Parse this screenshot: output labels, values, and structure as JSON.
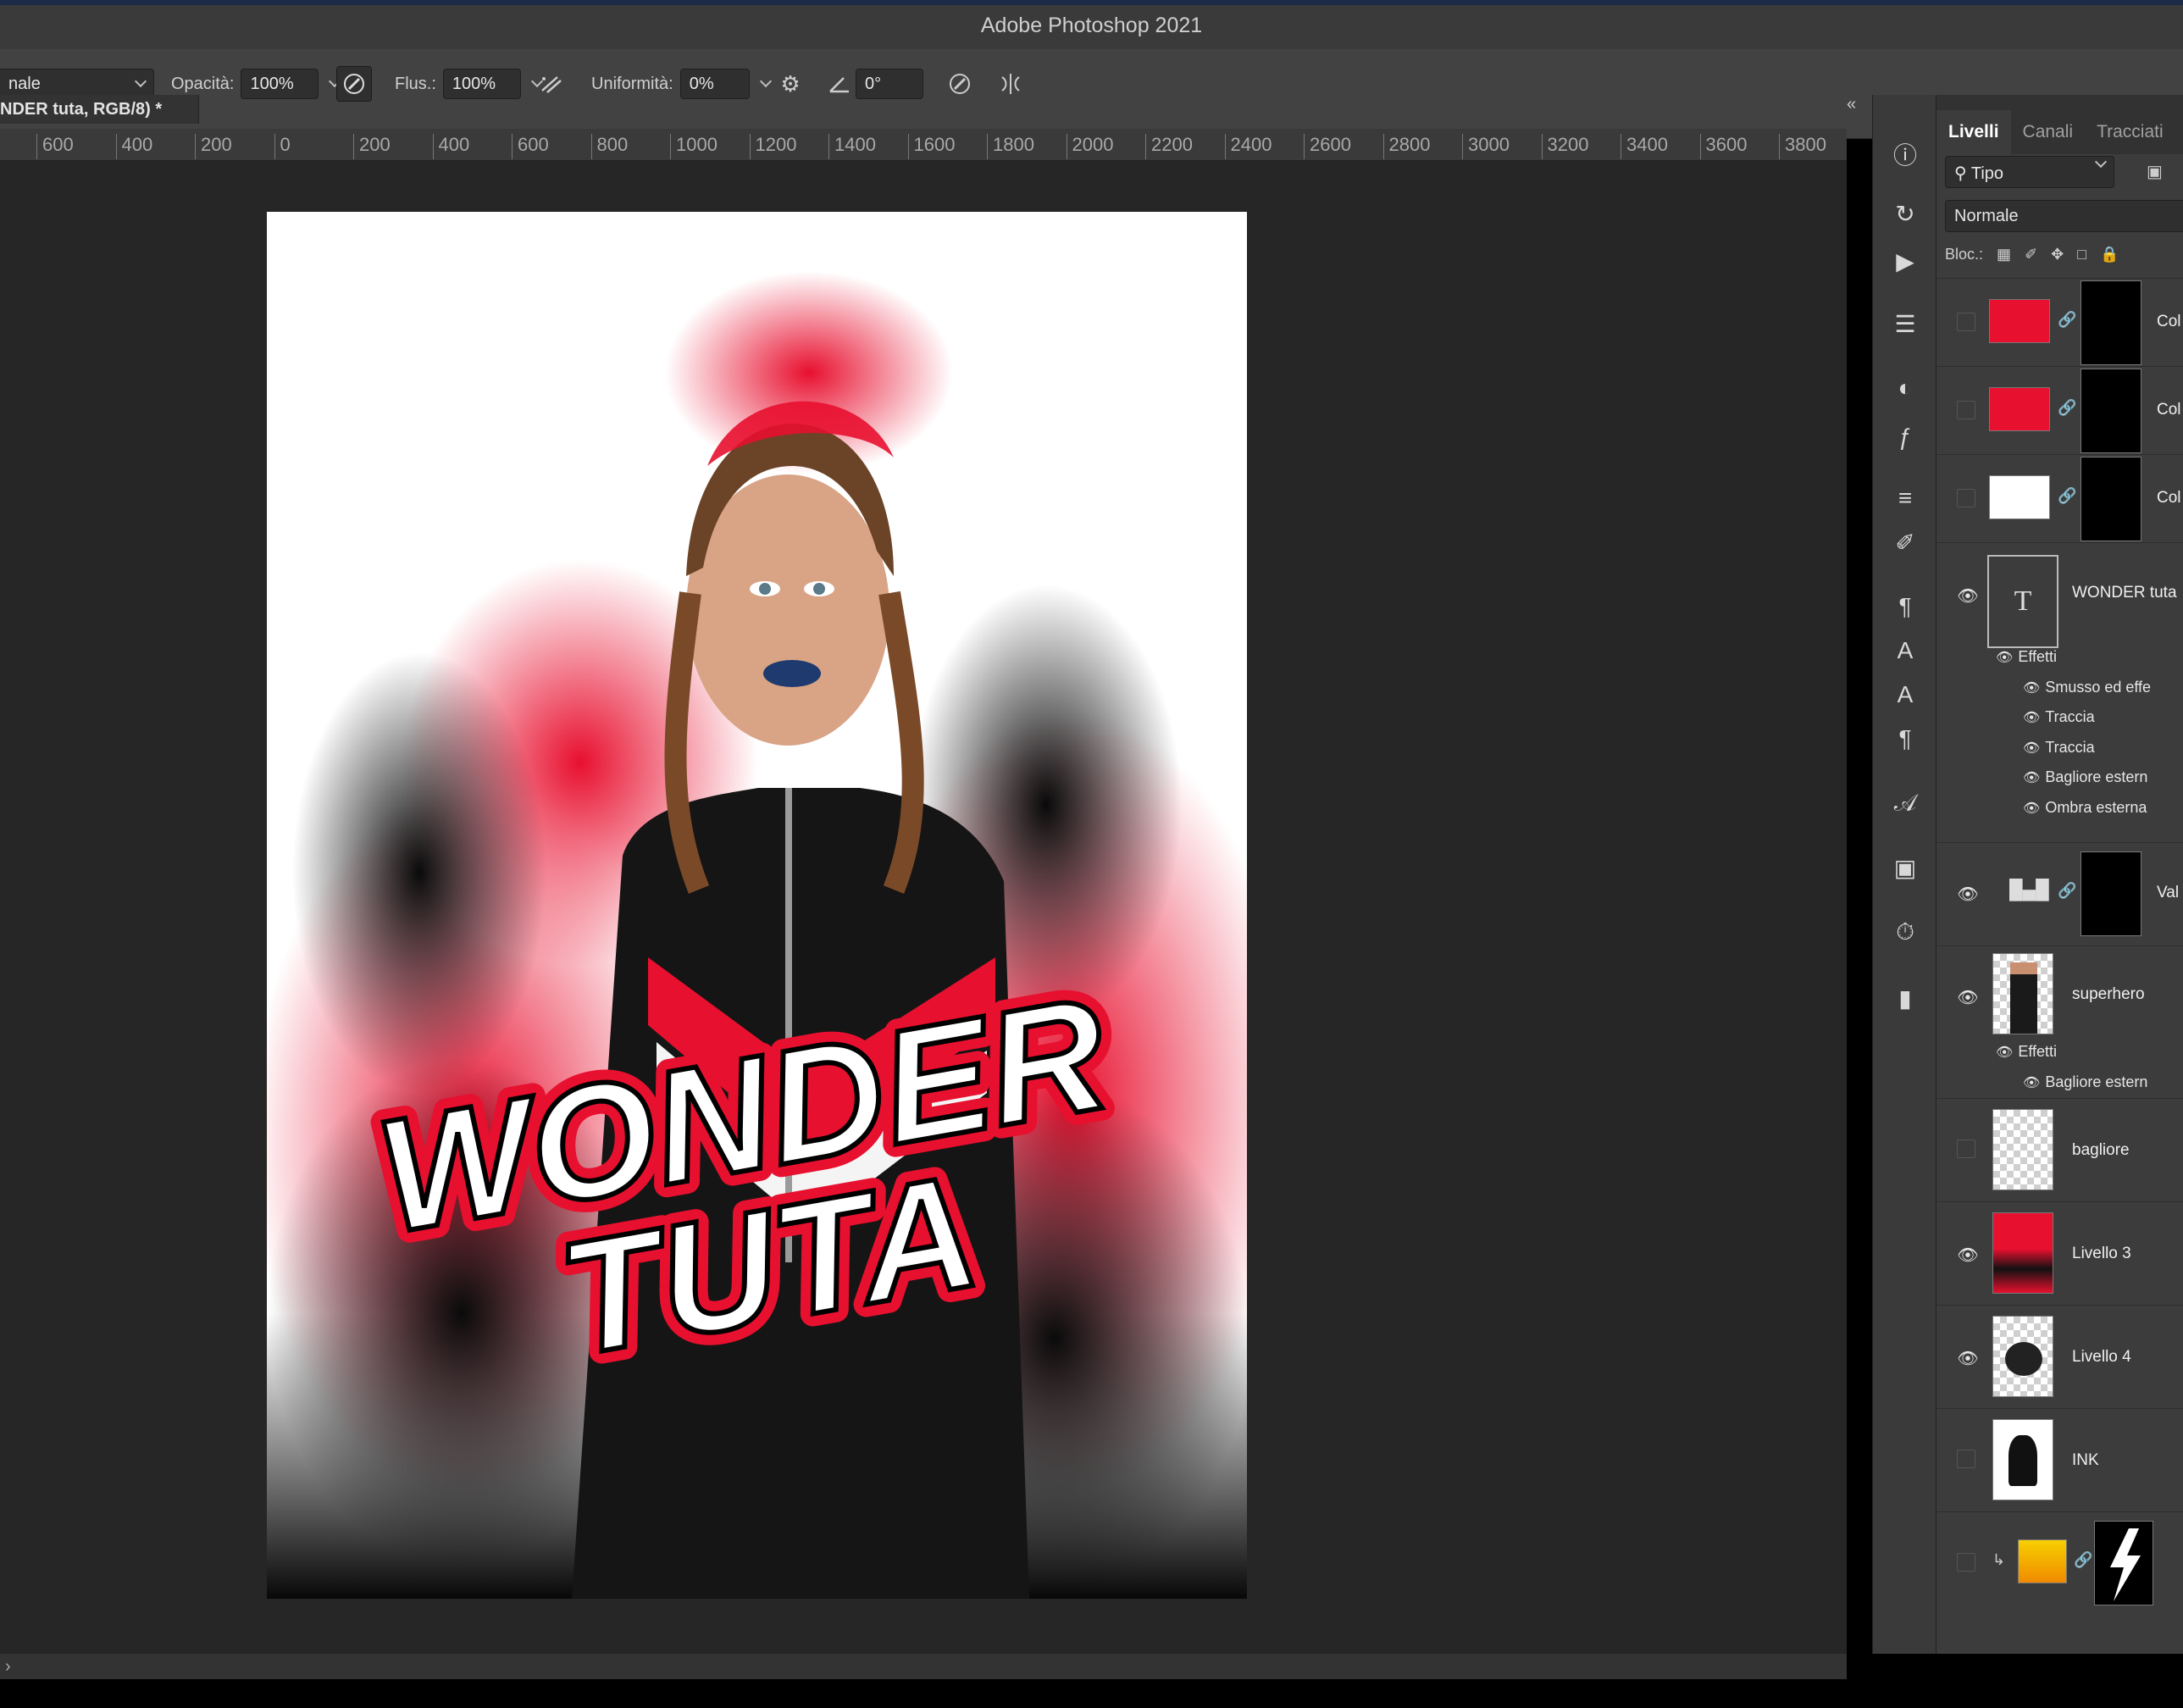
{
  "app_title": "Adobe Photoshop 2021",
  "options_bar": {
    "blend_mode": "nale",
    "opacity_label": "Opacità:",
    "opacity_value": "100%",
    "flow_label": "Flus.:",
    "flow_value": "100%",
    "smoothing_label": "Uniformità:",
    "smoothing_value": "0%",
    "angle_value": "0°"
  },
  "document_tab": "NDER tuta, RGB/8) *",
  "ruler_ticks": [
    "600",
    "400",
    "200",
    "0",
    "200",
    "400",
    "600",
    "800",
    "1000",
    "1200",
    "1400",
    "1600",
    "1800",
    "2000",
    "2200",
    "2400",
    "2600",
    "2800",
    "3000",
    "3200",
    "3400",
    "3600",
    "3800"
  ],
  "poster": {
    "line1": "WONDER",
    "line2": "TUTA",
    "accent": "#e8102f"
  },
  "panel": {
    "collapse": "«",
    "tabs": [
      "Livelli",
      "Canali",
      "Tracciati"
    ],
    "filter": "Tipo",
    "blend": "Normale",
    "lock_label": "Bloc.:"
  },
  "layers": [
    {
      "name": "Col",
      "visible": false,
      "thumb": "#e8102f"
    },
    {
      "name": "Col",
      "visible": false,
      "thumb": "#e8102f"
    },
    {
      "name": "Col",
      "visible": false,
      "thumb": "#ffffff"
    },
    {
      "name": "WONDER tuta",
      "visible": true,
      "type": "text",
      "effects_label": "Effetti",
      "effects": [
        "Smusso ed effe",
        "Traccia",
        "Traccia",
        "Bagliore estern",
        "Ombra esterna"
      ]
    },
    {
      "name": "Val",
      "visible": true,
      "type": "levels"
    },
    {
      "name": "superhero",
      "visible": true,
      "effects_label": "Effetti",
      "effects": [
        "Bagliore estern"
      ]
    },
    {
      "name": "bagliore",
      "visible": false
    },
    {
      "name": "Livello 3",
      "visible": true
    },
    {
      "name": "Livello 4",
      "visible": true
    },
    {
      "name": "INK",
      "visible": false
    },
    {
      "name": "",
      "visible": false,
      "thumb": "#f5b800"
    }
  ],
  "colors": {
    "panel_bg": "#3c3c3c",
    "workspace_bg": "#262626",
    "accent_red": "#e8102f"
  }
}
